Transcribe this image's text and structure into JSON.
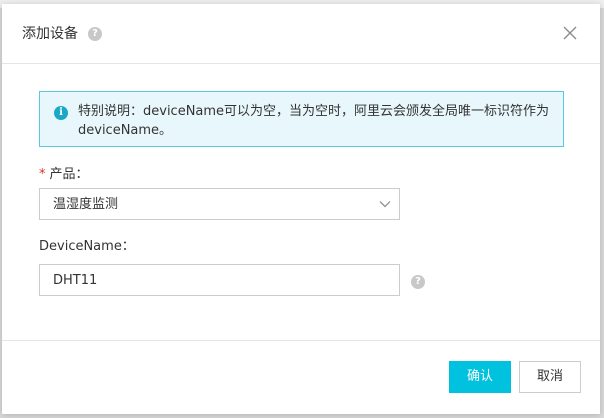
{
  "dialog": {
    "title": "添加设备",
    "help_glyph": "?",
    "close_icon": "close-icon"
  },
  "notice": {
    "icon_glyph": "i",
    "text": "特别说明：deviceName可以为空，当为空时，阿里云会颁发全局唯一标识符作为deviceName。"
  },
  "form": {
    "product": {
      "required_mark": "*",
      "label": "产品：",
      "selected_value": "温湿度监测"
    },
    "device_name": {
      "label": "DeviceName：",
      "value": "DHT11"
    }
  },
  "footer": {
    "confirm_label": "确认",
    "cancel_label": "取消"
  },
  "colors": {
    "accent": "#00c1de",
    "notice_border": "#5ac8dd",
    "notice_bg": "#e8f7fb",
    "required": "#e0302d"
  }
}
